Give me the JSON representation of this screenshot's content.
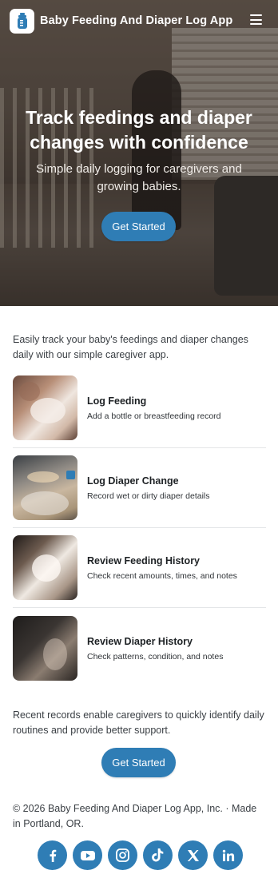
{
  "header": {
    "app_title": "Baby Feeding And Diaper Log App",
    "logo_icon": "baby-bottle-icon",
    "menu_icon": "hamburger-menu-icon"
  },
  "hero": {
    "title": "Track feedings and diaper changes with confidence",
    "subtitle": "Simple daily logging for caregivers and growing babies.",
    "cta_label": "Get Started"
  },
  "intro": {
    "text": "Easily track your baby's feedings and diaper changes daily with our simple caregiver app."
  },
  "features": [
    {
      "title": "Log Feeding",
      "description": "Add a bottle or breastfeeding record"
    },
    {
      "title": "Log Diaper Change",
      "description": "Record wet or dirty diaper details"
    },
    {
      "title": "Review Feeding History",
      "description": "Check recent amounts, times, and notes"
    },
    {
      "title": "Review Diaper History",
      "description": "Check patterns, condition, and notes"
    }
  ],
  "summary": {
    "text": "Recent records enable caregivers to quickly identify daily routines and provide better support.",
    "cta_label": "Get Started"
  },
  "footer": {
    "copyright": "© 2026 Baby Feeding And Diaper Log App, Inc. · Made in Portland, OR.",
    "socials": [
      "facebook-icon",
      "youtube-icon",
      "instagram-icon",
      "tiktok-icon",
      "x-icon",
      "linkedin-icon"
    ]
  },
  "colors": {
    "accent": "#2f7db5",
    "text": "#3a3f44",
    "divider": "#e3e5e7"
  }
}
